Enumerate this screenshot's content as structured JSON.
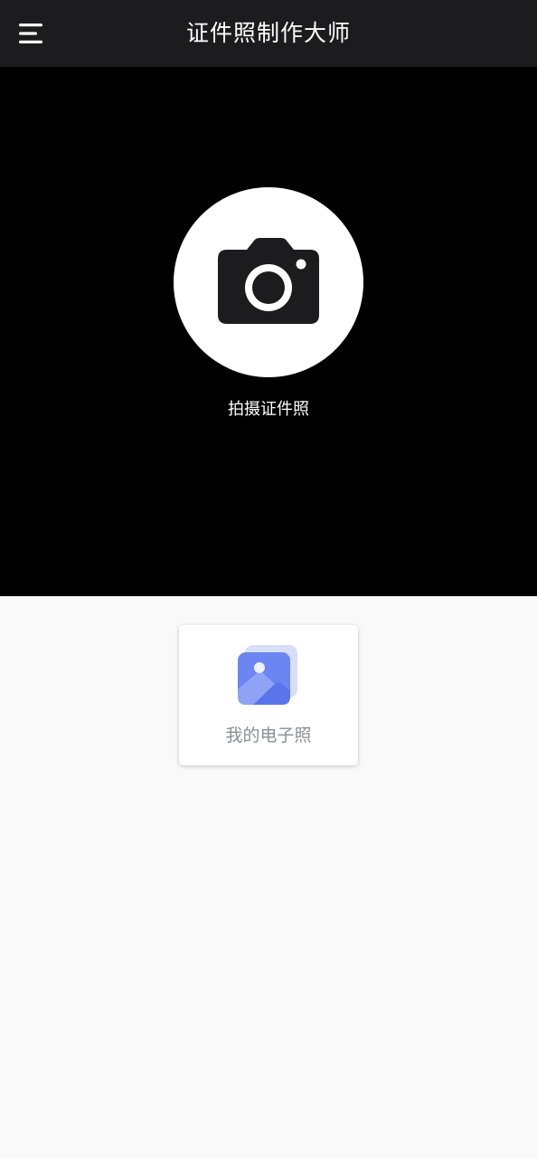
{
  "app_bar": {
    "title": "证件照制作大师",
    "menu_icon": "hamburger-menu-icon"
  },
  "camera_panel": {
    "icon": "camera-icon",
    "label": "拍摄证件照"
  },
  "photos_card": {
    "icon": "gallery-image-icon",
    "label": "我的电子照",
    "accent_color": "#6b85f2"
  },
  "colors": {
    "app_bar_bg": "#1c1c1e",
    "camera_panel_bg": "#000000",
    "page_bg": "#f9f9f9",
    "label_gray": "#8a8f99"
  }
}
